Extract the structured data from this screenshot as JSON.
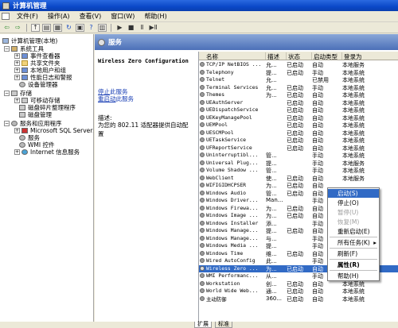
{
  "window": {
    "title": "计算机管理"
  },
  "menu": [
    "文件(F)",
    "操作(A)",
    "查看(V)",
    "窗口(W)",
    "帮助(H)"
  ],
  "toolbar": [
    "back-icon",
    "forward-icon",
    "up-icon",
    "show-tree-icon",
    "properties-icon",
    "refresh-icon",
    "export-icon",
    "help-icon",
    "play-icon",
    "stop-icon",
    "pause-icon",
    "restart-icon"
  ],
  "tree": [
    {
      "label": "计算机管理(本地)",
      "expander": "",
      "icon": "pc"
    },
    {
      "label": "系统工具",
      "expander": "−",
      "icon": "tool"
    },
    {
      "label": "事件查看器",
      "expander": "+",
      "icon": "blue"
    },
    {
      "label": "共享文件夹",
      "expander": "+",
      "icon": "folder"
    },
    {
      "label": "本地用户和组",
      "expander": "+",
      "icon": "blue"
    },
    {
      "label": "性能日志和警报",
      "expander": "+",
      "icon": "blue"
    },
    {
      "label": "设备管理器",
      "expander": "",
      "icon": "gear"
    },
    {
      "label": "存储",
      "expander": "−",
      "icon": "disk"
    },
    {
      "label": "可移动存储",
      "expander": "+",
      "icon": "disk"
    },
    {
      "label": "磁盘碎片整理程序",
      "expander": "",
      "icon": "disk"
    },
    {
      "label": "磁盘管理",
      "expander": "",
      "icon": "disk"
    },
    {
      "label": "服务和应用程序",
      "expander": "−",
      "icon": "gear"
    },
    {
      "label": "Microsoft SQL Servers",
      "expander": "+",
      "icon": "db"
    },
    {
      "label": "服务",
      "expander": "",
      "icon": "gear"
    },
    {
      "label": "WMI 控件",
      "expander": "",
      "icon": "gear"
    },
    {
      "label": "Internet 信息服务",
      "expander": "+",
      "icon": "globe"
    }
  ],
  "services_header": "服务",
  "detail": {
    "name": "Wireless Zero Configuration",
    "stop_link": "停止",
    "stop_rest": "此服务",
    "restart_link": "重启动",
    "restart_rest": "此服务",
    "desc_label": "描述:",
    "desc_text": "为您的 802.11 适配器提供自动配置"
  },
  "columns": [
    "名称",
    "描述",
    "状态",
    "启动类型",
    "登录为"
  ],
  "services": [
    [
      "TCP/IP NetBIOS ...",
      "允...",
      "已启动",
      "自动",
      "本地服务"
    ],
    [
      "Telephony",
      "提...",
      "已启动",
      "手动",
      "本地系统"
    ],
    [
      "Telnet",
      "允...",
      "",
      "已禁用",
      "本地系统"
    ],
    [
      "Terminal Services",
      "允...",
      "已启动",
      "手动",
      "本地系统"
    ],
    [
      "Themes",
      "为...",
      "已启动",
      "自动",
      "本地系统"
    ],
    [
      "UEAuthServer",
      "",
      "已启动",
      "自动",
      "本地系统"
    ],
    [
      "UEDispatchService",
      "",
      "已启动",
      "自动",
      "本地系统"
    ],
    [
      "UEKeyManagePool",
      "",
      "已启动",
      "自动",
      "本地系统"
    ],
    [
      "UEMPool",
      "",
      "已启动",
      "自动",
      "本地系统"
    ],
    [
      "UESCMPool",
      "",
      "已启动",
      "自动",
      "本地系统"
    ],
    [
      "UETaskService",
      "",
      "已启动",
      "自动",
      "本地系统"
    ],
    [
      "UFReportService",
      "",
      "已启动",
      "自动",
      "本地系统"
    ],
    [
      "Uninterruptibl...",
      "管...",
      "",
      "手动",
      "本地系统"
    ],
    [
      "Universal Plug...",
      "提...",
      "",
      "手动",
      "本地服务"
    ],
    [
      "Volume Shadow ...",
      "管...",
      "",
      "手动",
      "本地系统"
    ],
    [
      "WebClient",
      "使...",
      "已启动",
      "自动",
      "本地服务"
    ],
    [
      "WIFIGIDHCPSER",
      "为...",
      "已启动",
      "自动",
      ""
    ],
    [
      "Windows Audio",
      "管...",
      "已启动",
      "自动",
      ""
    ],
    [
      "Windows Driver...",
      "Man...",
      "",
      "手动",
      ""
    ],
    [
      "Windows Firewa...",
      "为...",
      "已启动",
      "自动",
      ""
    ],
    [
      "Windows Image ...",
      "为...",
      "已启动",
      "自动",
      ""
    ],
    [
      "Windows Installer",
      "添...",
      "",
      "手动",
      ""
    ],
    [
      "Windows Manage...",
      "提...",
      "已启动",
      "自动",
      ""
    ],
    [
      "Windows Manage...",
      "与...",
      "",
      "手动",
      ""
    ],
    [
      "Windows Media ...",
      "提...",
      "",
      "手动",
      ""
    ],
    [
      "Windows Time",
      "维...",
      "已启动",
      "自动",
      ""
    ],
    [
      "Wired AutoConfig",
      "此...",
      "",
      "手动",
      ""
    ],
    [
      "Wireless Zero ...",
      "为...",
      "已启动",
      "自动",
      ""
    ],
    [
      "WMI Performanc...",
      "从...",
      "",
      "手动",
      "本地系统"
    ],
    [
      "Workstation",
      "创...",
      "已启动",
      "自动",
      "本地系统"
    ],
    [
      "World Wide Web...",
      "通...",
      "已启动",
      "自动",
      "本地系统"
    ],
    [
      "主动防御",
      "360...",
      "已启动",
      "自动",
      "本地系统"
    ]
  ],
  "selected_index": 27,
  "context_menu": [
    {
      "label": "启动(S)",
      "state": "highlight"
    },
    {
      "label": "停止(O)",
      "state": "normal"
    },
    {
      "label": "暂停(U)",
      "state": "disabled"
    },
    {
      "label": "恢复(M)",
      "state": "disabled"
    },
    {
      "label": "重新启动(E)",
      "state": "normal"
    },
    {
      "label": "所有任务(K)",
      "state": "normal",
      "submenu": true
    },
    {
      "label": "刷新(F)",
      "state": "normal"
    },
    {
      "label": "属性(R)",
      "state": "bold"
    },
    {
      "label": "帮助(H)",
      "state": "normal"
    }
  ],
  "bottom_tabs": [
    "扩展",
    "标准"
  ]
}
